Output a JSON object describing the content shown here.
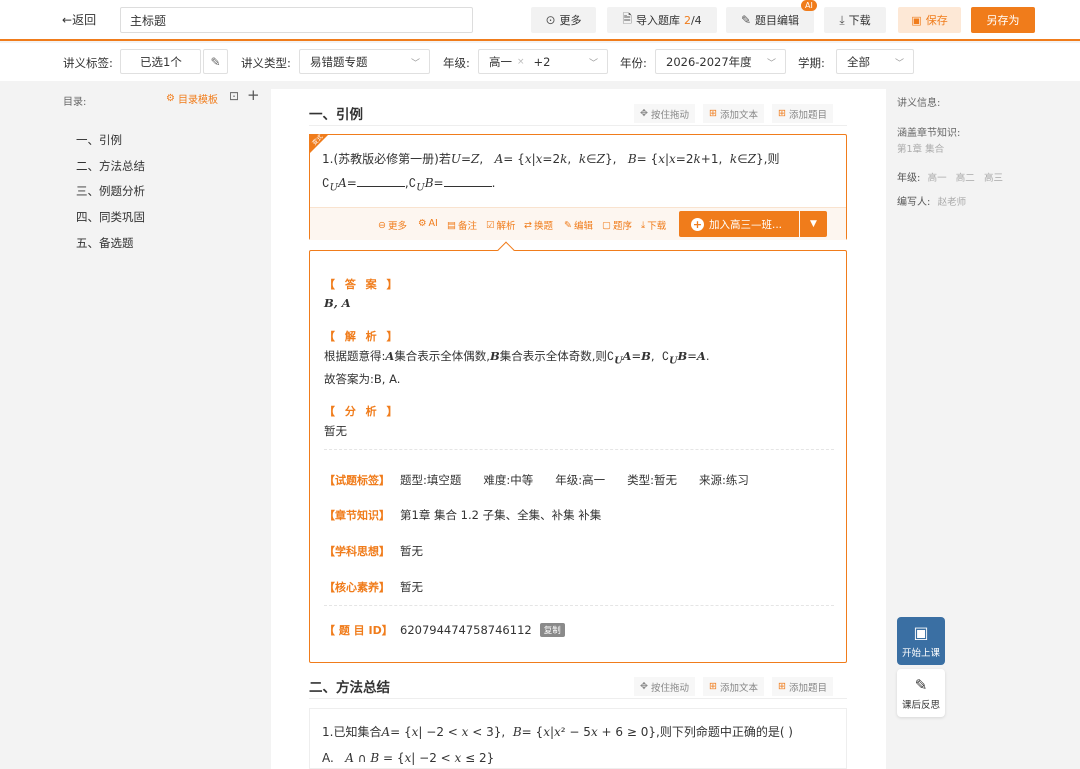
{
  "toolbar": {
    "back_label": "返回",
    "title_value": "主标题",
    "more_label": "更多",
    "import_label": "导入题库",
    "import_current": "2",
    "import_total": "/4",
    "edit_label": "题目编辑",
    "ai_badge": "AI",
    "download_label": "下载",
    "save_label": "保存",
    "save_as_label": "另存为"
  },
  "filters": {
    "tag_label": "讲义标签:",
    "tag_value": "已选1个",
    "type_label": "讲义类型:",
    "type_value": "易错题专题",
    "grade_label": "年级:",
    "grade_value": "高一",
    "grade_extra": "+2",
    "year_label": "年份:",
    "year_value": "2026-2027年度",
    "term_label": "学期:",
    "term_value": "全部"
  },
  "sidebar": {
    "toc_label": "目录:",
    "template_label": "目录模板",
    "items": [
      "一、引例",
      "二、方法总结",
      "三、例题分析",
      "四、同类巩固",
      "五、备选题"
    ]
  },
  "info": {
    "title": "讲义信息:",
    "chapter_label": "涵盖章节知识:",
    "chapter_value": "第1章 集合",
    "grade_label": "年级:",
    "grades": [
      "高一",
      "高二",
      "高三"
    ],
    "author_label": "编写人:",
    "author_value": "赵老师",
    "start_class_label": "开始上课",
    "reflect_label": "课后反思"
  },
  "section1": {
    "title": "一、引例",
    "drag_label": "按住拖动",
    "add_text_label": "添加文本",
    "add_question_label": "添加题目"
  },
  "question1": {
    "corner_tag": "变式",
    "prefix": "1.(苏教版必修第一册)若",
    "tools": [
      "更多",
      "AI",
      "备注",
      "解析",
      "换题",
      "编辑",
      "题序",
      "下载"
    ],
    "join_label": "加入高三—班..."
  },
  "answer": {
    "answer_head": "【 答 案 】",
    "answer_text": "B,   A",
    "analysis_head": "【 解 析 】",
    "analysis_line1_prefix": "根据题意得:",
    "analysis_line2": "故答案为:B,   A.",
    "review_head": "【 分 析 】",
    "review_text": "暂无"
  },
  "meta": {
    "tags_key": "【试题标签】",
    "tags": [
      "题型:填空题",
      "难度:中等",
      "年级:高一",
      "类型:暂无",
      "来源:练习"
    ],
    "chapter_key": "【章节知识】",
    "chapter_value": "第1章 集合  1.2 子集、全集、补集 补集",
    "thinking_key": "【学科思想】",
    "thinking_value": "暂无",
    "core_key": "【核心素养】",
    "core_value": "暂无",
    "id_key": "【 题 目 ID】",
    "id_value": "620794474758746112",
    "copy_label": "复制"
  },
  "section2": {
    "title": "二、方法总结",
    "drag_label": "按住拖动",
    "add_text_label": "添加文本",
    "add_question_label": "添加题目"
  },
  "question2": {
    "prefix": "1.已知集合",
    "suffix": ",则下列命题中正确的是(  )"
  },
  "colors": {
    "accent": "#f07c1b",
    "start_button": "#3a6fa3"
  }
}
